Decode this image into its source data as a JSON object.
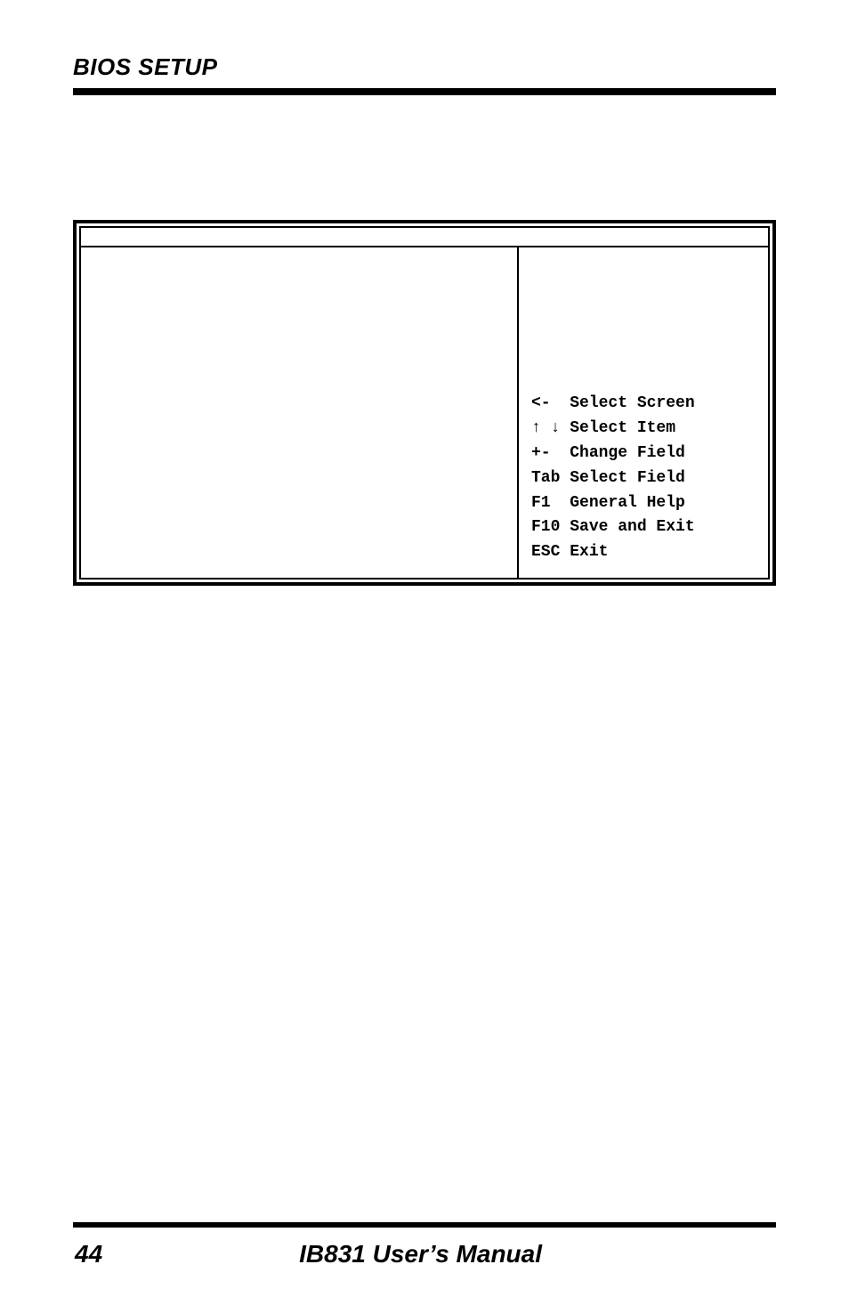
{
  "header": {
    "title": "BIOS SETUP"
  },
  "bios_help": {
    "lines": [
      {
        "key": "<-",
        "label": "Select Screen"
      },
      {
        "key": "↑ ↓",
        "label": "Select Item"
      },
      {
        "key": "+-",
        "label": "Change Field"
      },
      {
        "key": "Tab",
        "label": "Select Field"
      },
      {
        "key": "F1",
        "label": "General Help"
      },
      {
        "key": "F10",
        "label": "Save and Exit"
      },
      {
        "key": "ESC",
        "label": "Exit"
      }
    ]
  },
  "footer": {
    "page_number": "44",
    "manual_title": "IB831 User’s Manual"
  }
}
